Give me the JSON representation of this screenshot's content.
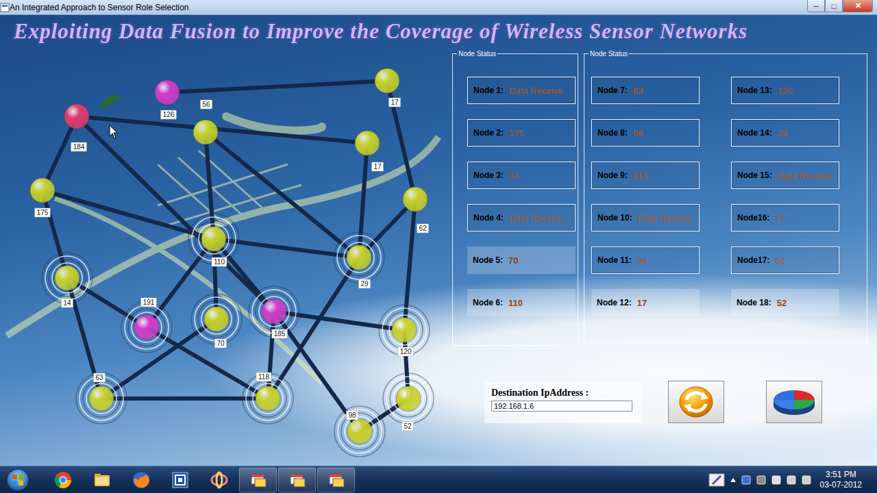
{
  "window": {
    "title": "An Integrated Approach to Sensor Role Selection",
    "controls": [
      "─",
      "□",
      "✕"
    ]
  },
  "heading": "Exploiting Data Fusion to Improve the Coverage of Wireless Sensor Networks",
  "network": {
    "nodes": [
      {
        "label": "184",
        "color": "#e23c6e",
        "rings": false
      },
      {
        "label": "126",
        "color": "#d23cc8",
        "rings": false
      },
      {
        "label": "56",
        "color": "#c6d12a",
        "rings": false
      },
      {
        "label": "17",
        "color": "#c6d12a",
        "rings": false
      },
      {
        "label": "17",
        "color": "#c6d12a",
        "rings": false
      },
      {
        "label": "175",
        "color": "#c6d12a",
        "rings": false
      },
      {
        "label": "62",
        "color": "#c6d12a",
        "rings": false
      },
      {
        "label": "110",
        "color": "#c6d12a",
        "rings": true
      },
      {
        "label": "29",
        "color": "#c6d12a",
        "rings": true
      },
      {
        "label": "14",
        "color": "#c6d12a",
        "rings": true
      },
      {
        "label": "191",
        "color": "#d23cc8",
        "rings": true
      },
      {
        "label": "70",
        "color": "#c6d12a",
        "rings": true
      },
      {
        "label": "185",
        "color": "#d23cc8",
        "rings": true
      },
      {
        "label": "120",
        "color": "#c6d12a",
        "rings": true
      },
      {
        "label": "63",
        "color": "#c6d12a",
        "rings": true
      },
      {
        "label": "118",
        "color": "#c6d12a",
        "rings": true
      },
      {
        "label": "52",
        "color": "#c6d12a",
        "rings": true
      },
      {
        "label": "98",
        "color": "#c6d12a",
        "rings": true
      }
    ],
    "edges": [
      [
        1,
        3
      ],
      [
        0,
        4
      ],
      [
        0,
        5
      ],
      [
        0,
        12
      ],
      [
        2,
        7
      ],
      [
        2,
        8
      ],
      [
        3,
        6
      ],
      [
        4,
        8
      ],
      [
        6,
        8
      ],
      [
        6,
        13
      ],
      [
        5,
        7
      ],
      [
        5,
        9
      ],
      [
        7,
        8
      ],
      [
        7,
        10
      ],
      [
        7,
        11
      ],
      [
        7,
        12
      ],
      [
        9,
        10
      ],
      [
        9,
        14
      ],
      [
        10,
        15
      ],
      [
        11,
        14
      ],
      [
        12,
        15
      ],
      [
        12,
        17
      ],
      [
        12,
        13
      ],
      [
        8,
        15
      ],
      [
        14,
        15
      ],
      [
        16,
        17
      ],
      [
        13,
        16
      ]
    ]
  },
  "node_status": [
    {
      "title": "Node Status",
      "items": [
        {
          "label": "Node 1:",
          "value": "Data Receive",
          "framed": true
        },
        {
          "label": "Node 2:",
          "value": "175",
          "framed": true
        },
        {
          "label": "Node 3:",
          "value": "14",
          "framed": true
        },
        {
          "label": "Node 4:",
          "value": "Data Receive",
          "framed": true
        },
        {
          "label": "Node 5:",
          "value": "70",
          "framed": false
        },
        {
          "label": "Node 6:",
          "value": "110",
          "framed": false
        }
      ]
    },
    {
      "title": "Node Status",
      "items": [
        {
          "label": "Node 7:",
          "value": "63",
          "framed": true
        },
        {
          "label": "Node 8:",
          "value": "56",
          "framed": true
        },
        {
          "label": "Node 9:",
          "value": "118",
          "framed": true
        },
        {
          "label": "Node 10:",
          "value": "Data Receive",
          "framed": true
        },
        {
          "label": "Node 11:",
          "value": "98",
          "framed": true
        },
        {
          "label": "Node 12:",
          "value": "17",
          "framed": false
        },
        {
          "label": "Node 13:",
          "value": "120",
          "framed": true
        },
        {
          "label": "Node 14:",
          "value": "29",
          "framed": true
        },
        {
          "label": "Node 15:",
          "value": "Data Receive",
          "framed": true
        },
        {
          "label": "Node16:",
          "value": "17",
          "framed": true
        },
        {
          "label": "Node17:",
          "value": "62",
          "framed": true
        },
        {
          "label": "Node 18:",
          "value": "52",
          "framed": false
        }
      ]
    }
  ],
  "destination": {
    "label": "Destination IpAddress :",
    "value": "192.168.1.6"
  },
  "taskbar": {
    "time": "3:51 PM",
    "date": "03-07-2012"
  }
}
